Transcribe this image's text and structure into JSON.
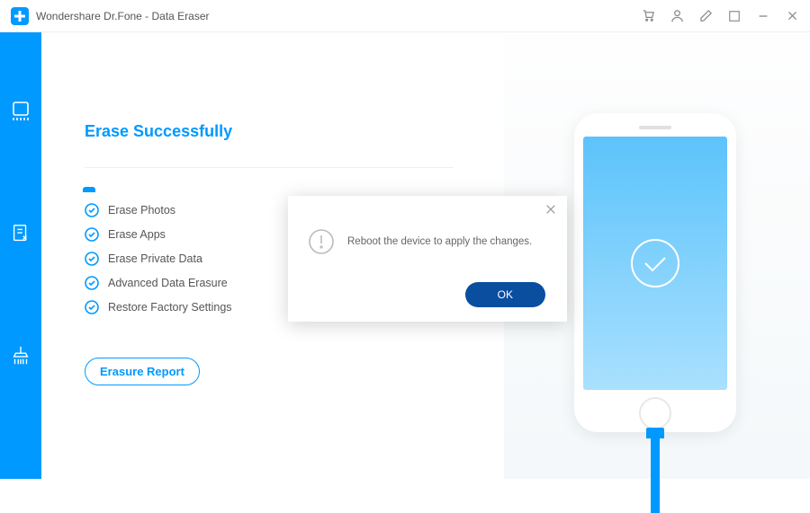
{
  "titlebar": {
    "app_title": "Wondershare Dr.Fone - Data Eraser"
  },
  "main": {
    "heading": "Erase Successfully",
    "tasks": [
      "Erase Photos",
      "Erase Apps",
      "Erase Private Data",
      "Advanced Data Erasure",
      "Restore Factory Settings"
    ],
    "report_button": "Erasure Report"
  },
  "modal": {
    "message": "Reboot the device to apply the changes.",
    "ok_label": "OK"
  },
  "colors": {
    "primary": "#0099ff",
    "modal_button": "#0a4ea0"
  }
}
